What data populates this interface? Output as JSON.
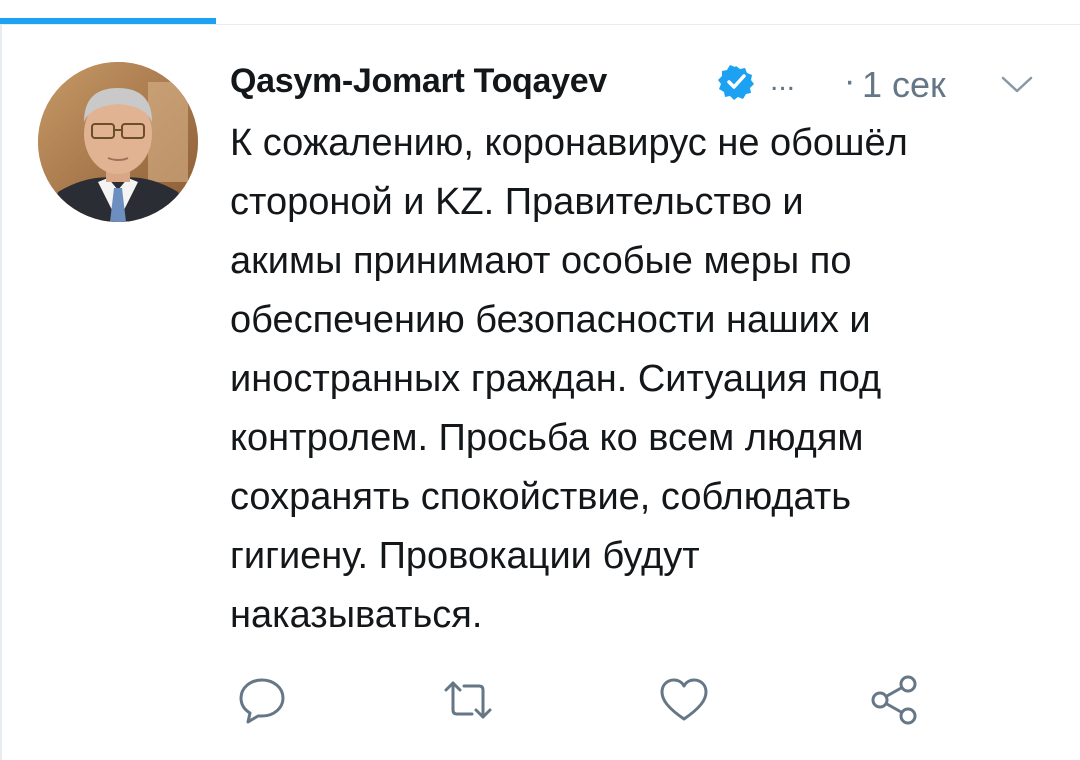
{
  "tweet": {
    "author_name": "Qasym-Jomart Toqayev",
    "verified_icon": "verified-badge-icon",
    "handle_truncated": "...",
    "separator": "·",
    "time": "1 сек",
    "text_lines": [
      "К сожалению, коронавирус не обошёл",
      "стороной и KZ. Правительство и",
      "акимы принимают особые меры по",
      "обеспечению безопасности наших и",
      "иностранных граждан. Ситуация под",
      "контролем. Просьба ко всем людям",
      "сохранять спокойствие, соблюдать",
      "гигиену. Провокации будут",
      "наказываться."
    ]
  },
  "actions": [
    {
      "icon": "reply-icon"
    },
    {
      "icon": "retweet-icon"
    },
    {
      "icon": "like-icon"
    },
    {
      "icon": "share-icon"
    }
  ],
  "colors": {
    "accent": "#1da1f2",
    "text": "#14171a",
    "secondary": "#657786",
    "icon": "#657786"
  }
}
